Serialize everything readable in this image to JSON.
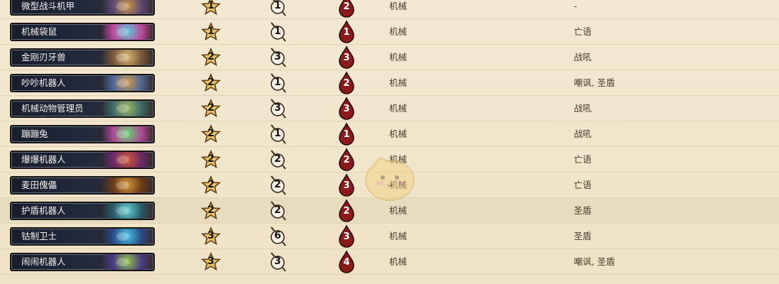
{
  "rows": [
    {
      "name": "微型战斗机甲",
      "attack": "1",
      "health": "1",
      "cost": "2",
      "type": "机械",
      "ability": "-",
      "art": [
        "#d89b4a",
        "#5c4a7a"
      ]
    },
    {
      "name": "机械袋鼠",
      "attack": "1",
      "health": "1",
      "cost": "1",
      "type": "机械",
      "ability": "亡语",
      "art": [
        "#5fd3e8",
        "#c64aa0"
      ]
    },
    {
      "name": "金刚刃牙兽",
      "attack": "2",
      "health": "3",
      "cost": "3",
      "type": "机械",
      "ability": "战吼",
      "art": [
        "#e6c27a",
        "#7a5a3a"
      ]
    },
    {
      "name": "吵吵机器人",
      "attack": "2",
      "health": "1",
      "cost": "2",
      "type": "机械",
      "ability": "嘲讽, 圣盾",
      "art": [
        "#d6a255",
        "#4e6a9a"
      ]
    },
    {
      "name": "机械动物管理员",
      "attack": "2",
      "health": "3",
      "cost": "3",
      "type": "机械",
      "ability": "战吼",
      "art": [
        "#a3c26a",
        "#3f6a6a"
      ]
    },
    {
      "name": "蹦蹦兔",
      "attack": "2",
      "health": "1",
      "cost": "1",
      "type": "机械",
      "ability": "战吼",
      "art": [
        "#6ee07a",
        "#b04a9a"
      ]
    },
    {
      "name": "爆爆机器人",
      "attack": "2",
      "health": "2",
      "cost": "2",
      "type": "机械",
      "ability": "亡语",
      "art": [
        "#e05a3a",
        "#6a2a6a"
      ]
    },
    {
      "name": "麦田傀儡",
      "attack": "2",
      "health": "2",
      "cost": "3",
      "type": "机械",
      "ability": "亡语",
      "art": [
        "#e0a03a",
        "#6a3a1a"
      ]
    },
    {
      "name": "护盾机器人",
      "attack": "2",
      "health": "2",
      "cost": "2",
      "type": "机械",
      "ability": "圣盾",
      "art": [
        "#6adfe0",
        "#2a5a6a"
      ],
      "highlight": true
    },
    {
      "name": "钴制卫士",
      "attack": "3",
      "health": "6",
      "cost": "3",
      "type": "机械",
      "ability": "圣盾",
      "art": [
        "#4ad0f0",
        "#2a4a8a"
      ]
    },
    {
      "name": "闹闹机器人",
      "attack": "3",
      "health": "3",
      "cost": "4",
      "type": "机械",
      "ability": "嘲讽, 圣盾",
      "art": [
        "#9ad04a",
        "#4a3a8a"
      ]
    }
  ]
}
